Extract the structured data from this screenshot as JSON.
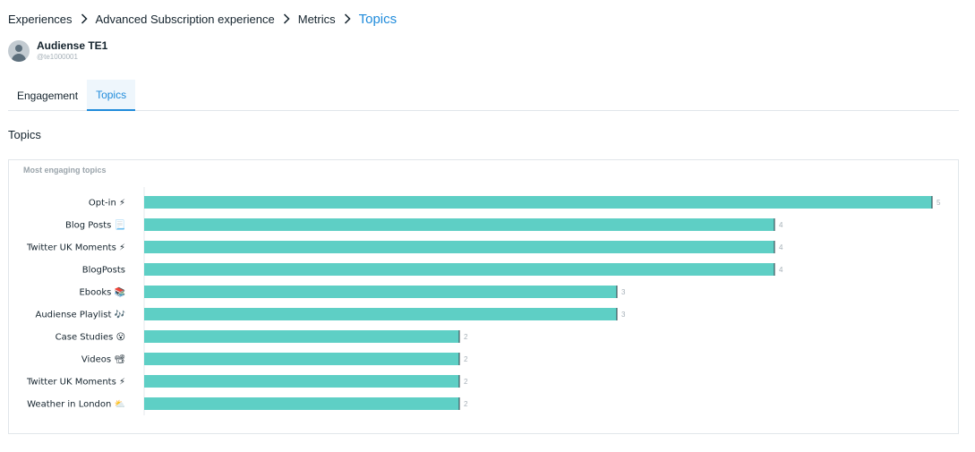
{
  "breadcrumb": {
    "items": [
      "Experiences",
      "Advanced Subscription experience",
      "Metrics"
    ],
    "current": "Topics"
  },
  "profile": {
    "name": "Audiense TE1",
    "handle": "@te1000001"
  },
  "tabs": [
    {
      "label": "Engagement",
      "active": false
    },
    {
      "label": "Topics",
      "active": true
    }
  ],
  "section_title": "Topics",
  "chart_panel": {
    "title": "Most engaging topics"
  },
  "colors": {
    "bar": "#5ecfc5",
    "accent": "#1f8bdb"
  },
  "chart_data": {
    "type": "bar",
    "orientation": "horizontal",
    "categories": [
      "Opt-in ⚡",
      "Blog Posts 📃",
      "Twitter UK Moments ⚡",
      "BlogPosts",
      "Ebooks 📚",
      "Audiense Playlist 🎶",
      "Case Studies 😮",
      "Videos 📽",
      "Twitter UK Moments ⚡",
      "Weather in London ⛅"
    ],
    "values": [
      5,
      4,
      4,
      4,
      3,
      3,
      2,
      2,
      2,
      2
    ],
    "xlim": [
      0,
      5
    ],
    "grid": false,
    "legend": "none"
  }
}
